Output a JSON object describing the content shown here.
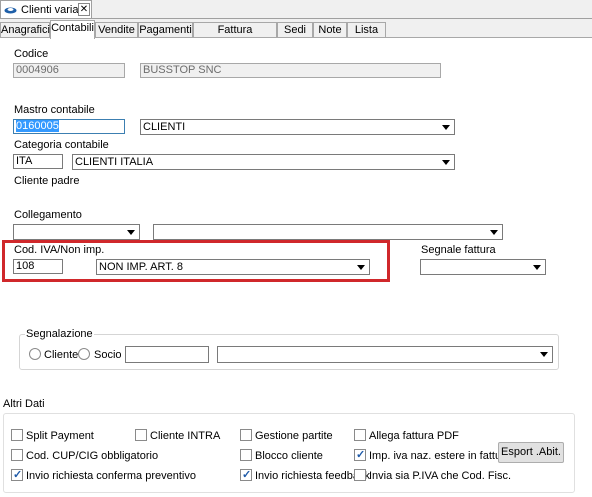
{
  "window": {
    "title": "Clienti varia",
    "close_glyph": "✕"
  },
  "tabs": [
    "Anagrafici",
    "Contabili",
    "Vendite",
    "Pagamenti",
    "Fattura elettronica",
    "Sedi",
    "Note",
    "Lista"
  ],
  "active_tab": "Contabili",
  "codice": {
    "label": "Codice",
    "code": "0004906",
    "name": "BUSSTOP SNC"
  },
  "mastro": {
    "label": "Mastro contabile",
    "code": "0160005",
    "description": "CLIENTI"
  },
  "categoria": {
    "label": "Categoria contabile",
    "code": "ITA",
    "description": "CLIENTI ITALIA"
  },
  "cliente_padre": {
    "label": "Cliente padre"
  },
  "collegamento": {
    "label": "Collegamento",
    "value1": "",
    "value2": ""
  },
  "cod_iva": {
    "label": "Cod. IVA/Non imp.",
    "code": "108",
    "description": "NON IMP. ART. 8"
  },
  "segnale_fattura": {
    "label": "Segnale fattura",
    "value": ""
  },
  "segnalazione": {
    "label": "Segnalazione",
    "radio_cliente": "Cliente",
    "radio_socio": "Socio",
    "code": "",
    "value": ""
  },
  "altri_dati": {
    "label": "Altri Dati",
    "checkboxes": [
      {
        "label": "Split Payment",
        "checked": false
      },
      {
        "label": "Cliente INTRA",
        "checked": false
      },
      {
        "label": "Gestione partite",
        "checked": false
      },
      {
        "label": "Allega fattura PDF",
        "checked": false
      },
      {
        "label": "Cod. CUP/CIG obbligatorio",
        "checked": false
      },
      {
        "label": "Blocco cliente",
        "checked": false
      },
      {
        "label": "Imp. iva naz. estere in fattura",
        "checked": true
      },
      {
        "label": "Invio richiesta conferma preventivo",
        "checked": true
      },
      {
        "label": "Invio richiesta feedback",
        "checked": true
      },
      {
        "label": "Invia sia P.IVA che Cod. Fisc.",
        "checked": false
      }
    ],
    "button": "Esport .Abit."
  },
  "colors": {
    "highlight_box": "#d0282b",
    "selection": "#3399ff",
    "check_mark": "#1e5aa8"
  }
}
